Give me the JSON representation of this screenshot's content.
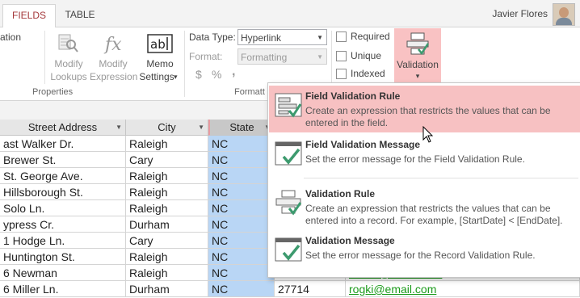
{
  "tabs": [
    {
      "label": "FIELDS",
      "active": true
    },
    {
      "label": "TABLE",
      "active": false
    }
  ],
  "user": {
    "name": "Javier Flores"
  },
  "ribbon": {
    "partial_label": "ation",
    "modify_lookups": {
      "line1": "Modify",
      "line2": "Lookups"
    },
    "modify_expression": {
      "line1": "Modify",
      "line2": "Expression"
    },
    "memo_settings": {
      "line1": "Memo",
      "line2": "Settings"
    },
    "properties_group": "Properties",
    "data_type_label": "Data Type:",
    "data_type_value": "Hyperlink",
    "format_label": "Format:",
    "format_value": "Formatting",
    "format_symbols": {
      "currency": "$",
      "percent": "%",
      "comma": ","
    },
    "formatting_group": "Formatt",
    "required_label": "Required",
    "unique_label": "Unique",
    "indexed_label": "Indexed",
    "validation_label": "Validation",
    "dropdown_arrow": "▾"
  },
  "table": {
    "headers": [
      "Street Address",
      "City",
      "State"
    ],
    "rows": [
      {
        "street": "ast Walker Dr.",
        "city": "Raleigh",
        "state": "NC"
      },
      {
        "street": "Brewer St.",
        "city": "Cary",
        "state": "NC"
      },
      {
        "street": "St. George Ave.",
        "city": "Raleigh",
        "state": "NC"
      },
      {
        "street": "Hillsborough St.",
        "city": "Raleigh",
        "state": "NC"
      },
      {
        "street": "Solo Ln.",
        "city": "Raleigh",
        "state": "NC"
      },
      {
        "street": "ypress Cr.",
        "city": "Durham",
        "state": "NC"
      },
      {
        "street": "1 Hodge Ln.",
        "city": "Cary",
        "state": "NC"
      },
      {
        "street": "Huntington St.",
        "city": "Raleigh",
        "state": "NC"
      },
      {
        "street": "6 Newman",
        "city": "Raleigh",
        "state": "NC",
        "zip": "27606",
        "email": "mshin@email.com"
      },
      {
        "street": "6 Miller Ln.",
        "city": "Durham",
        "state": "NC",
        "zip": "27714",
        "email": "rogki@email.com"
      }
    ]
  },
  "menu": {
    "items": [
      {
        "title": "Field Validation Rule",
        "desc": "Create an expression that restricts the values that can be entered in the field.",
        "highlighted": true
      },
      {
        "title": "Field Validation Message",
        "desc": "Set the error message for the Field Validation Rule.",
        "highlighted": false
      },
      {
        "title": "Validation Rule",
        "desc": "Create an expression that restricts the values that can be entered into a record.  For example, [StartDate] < [EndDate].",
        "highlighted": false
      },
      {
        "title": "Validation Message",
        "desc": "Set the error message for the Record Validation Rule.",
        "highlighted": false
      }
    ]
  },
  "colors": {
    "accent": "#a4373a",
    "highlight": "#f7c1c2",
    "state_column": "#b9d6f5",
    "link": "#1a9a1a"
  }
}
